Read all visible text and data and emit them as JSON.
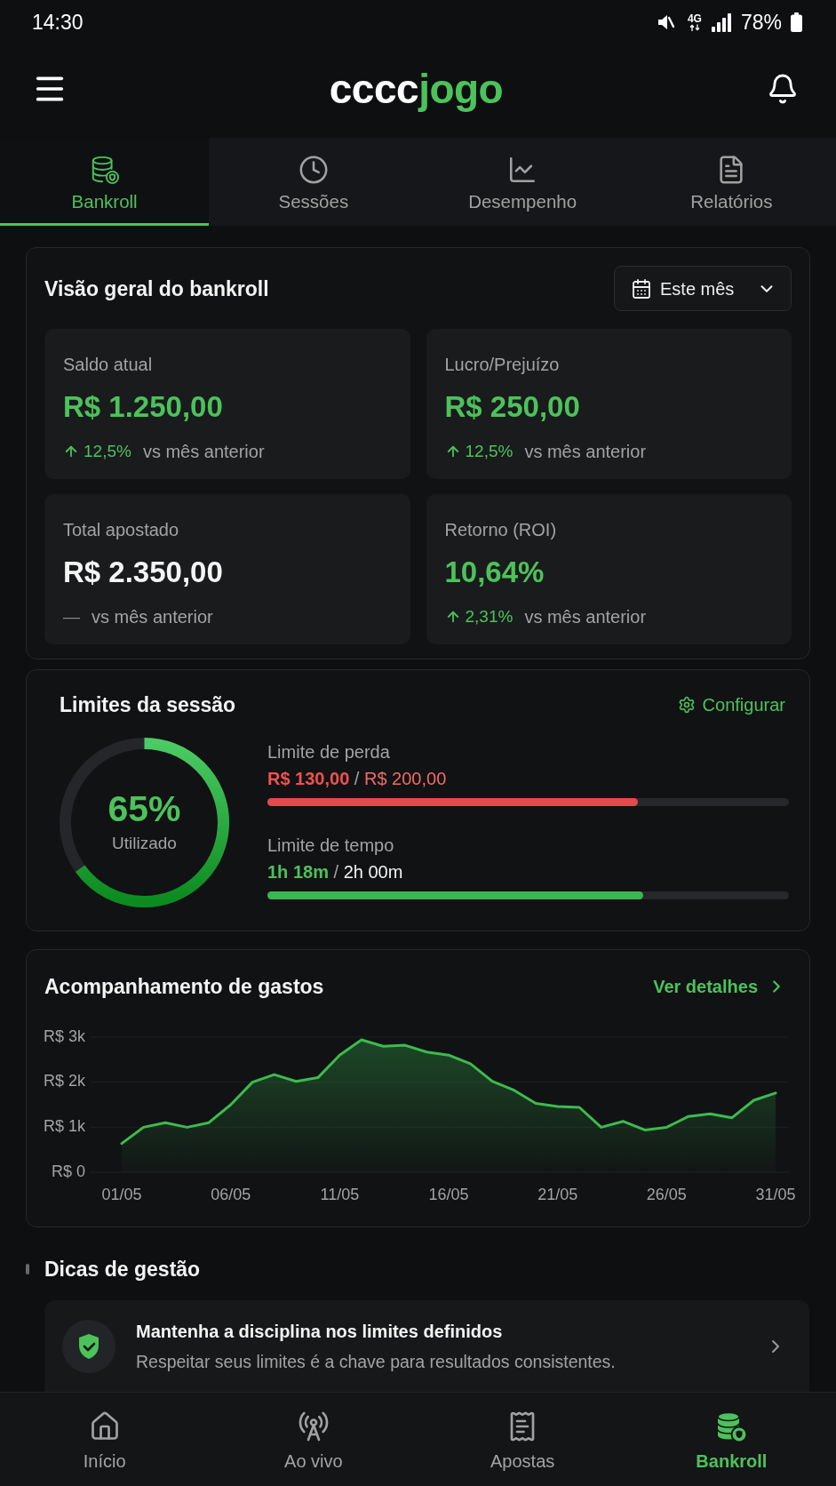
{
  "status_bar": {
    "time": "14:30",
    "network": "4G",
    "battery": "78%"
  },
  "header": {
    "logo": {
      "text": "cccc",
      "accent": "jogo"
    }
  },
  "tabs": [
    {
      "label": "Bankroll",
      "selected": true
    },
    {
      "label": "Sessões",
      "selected": false
    },
    {
      "label": "Desempenho",
      "selected": false
    },
    {
      "label": "Relatórios",
      "selected": false
    }
  ],
  "overview": {
    "title": "Visão geral do bankroll",
    "period": "Este mês",
    "metrics": [
      {
        "label": "Saldo atual",
        "value": "R$ 1.250,00",
        "highlighted": true,
        "rising": true,
        "change": "12,5%",
        "note": "vs mês anterior"
      },
      {
        "label": "Lucro/Prejuízo",
        "value": "R$ 250,00",
        "highlighted": true,
        "rising": true,
        "change": "12,5%",
        "note": "vs mês anterior"
      },
      {
        "label": "Total apostado",
        "value": "R$ 2.350,00",
        "highlighted": false,
        "rising": false,
        "change": "—",
        "note": "vs mês anterior"
      },
      {
        "label": "Retorno (ROI)",
        "value": "10,64%",
        "highlighted": true,
        "rising": true,
        "change": "2,31%",
        "note": "vs mês anterior"
      }
    ]
  },
  "session_limits": {
    "title": "Limites da sessão",
    "action": "Configurar",
    "ring": {
      "value": "65%",
      "caption": "Utilizado",
      "level": 0.65
    },
    "limits": [
      {
        "kind": "loss",
        "label": "Limite de perda",
        "used": "R$ 130,00",
        "separator": "/",
        "total": "R$ 200,00",
        "level": 0.71
      },
      {
        "kind": "time",
        "label": "Limite de tempo",
        "used": "1h 18m",
        "separator": "/",
        "total": "2h 00m",
        "level": 0.72
      }
    ]
  },
  "spending": {
    "title": "Acompanhamento de gastos",
    "action": "Ver detalhes",
    "y_axis_labels": [
      "R$ 3k",
      "R$ 2k",
      "R$ 1k",
      "R$ 0"
    ],
    "x_axis_labels": [
      "01/05",
      "06/05",
      "11/05",
      "16/05",
      "21/05",
      "26/05",
      "31/05"
    ]
  },
  "tips": {
    "title": "Dicas de gestão",
    "items": [
      {
        "title": "Mantenha a disciplina nos limites definidos",
        "text": "Respeitar seus limites é a chave para resultados consistentes."
      }
    ]
  },
  "bottom_nav": [
    {
      "label": "Início",
      "selected": false
    },
    {
      "label": "Ao vivo",
      "selected": false
    },
    {
      "label": "Apostas",
      "selected": false
    },
    {
      "label": "Bankroll",
      "selected": true
    }
  ]
}
